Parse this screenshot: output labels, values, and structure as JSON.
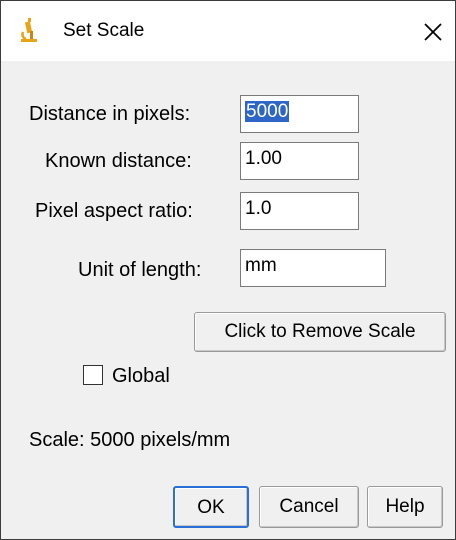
{
  "window": {
    "title": "Set Scale",
    "icon": "microscope-icon",
    "close_icon": "close-icon"
  },
  "form": {
    "distance_label": "Distance in pixels:",
    "distance_value": "5000",
    "known_label": "Known distance:",
    "known_value": "1.00",
    "aspect_label": "Pixel aspect ratio:",
    "aspect_value": "1.0",
    "unit_label": "Unit of length:",
    "unit_value": "mm"
  },
  "remove_scale_label": "Click to Remove Scale",
  "global": {
    "label": "Global",
    "checked": false
  },
  "scale_text": "Scale: 5000 pixels/mm",
  "buttons": {
    "ok": "OK",
    "cancel": "Cancel",
    "help": "Help"
  },
  "colors": {
    "selection": "#2d66c6",
    "icon": "#e8a317"
  }
}
